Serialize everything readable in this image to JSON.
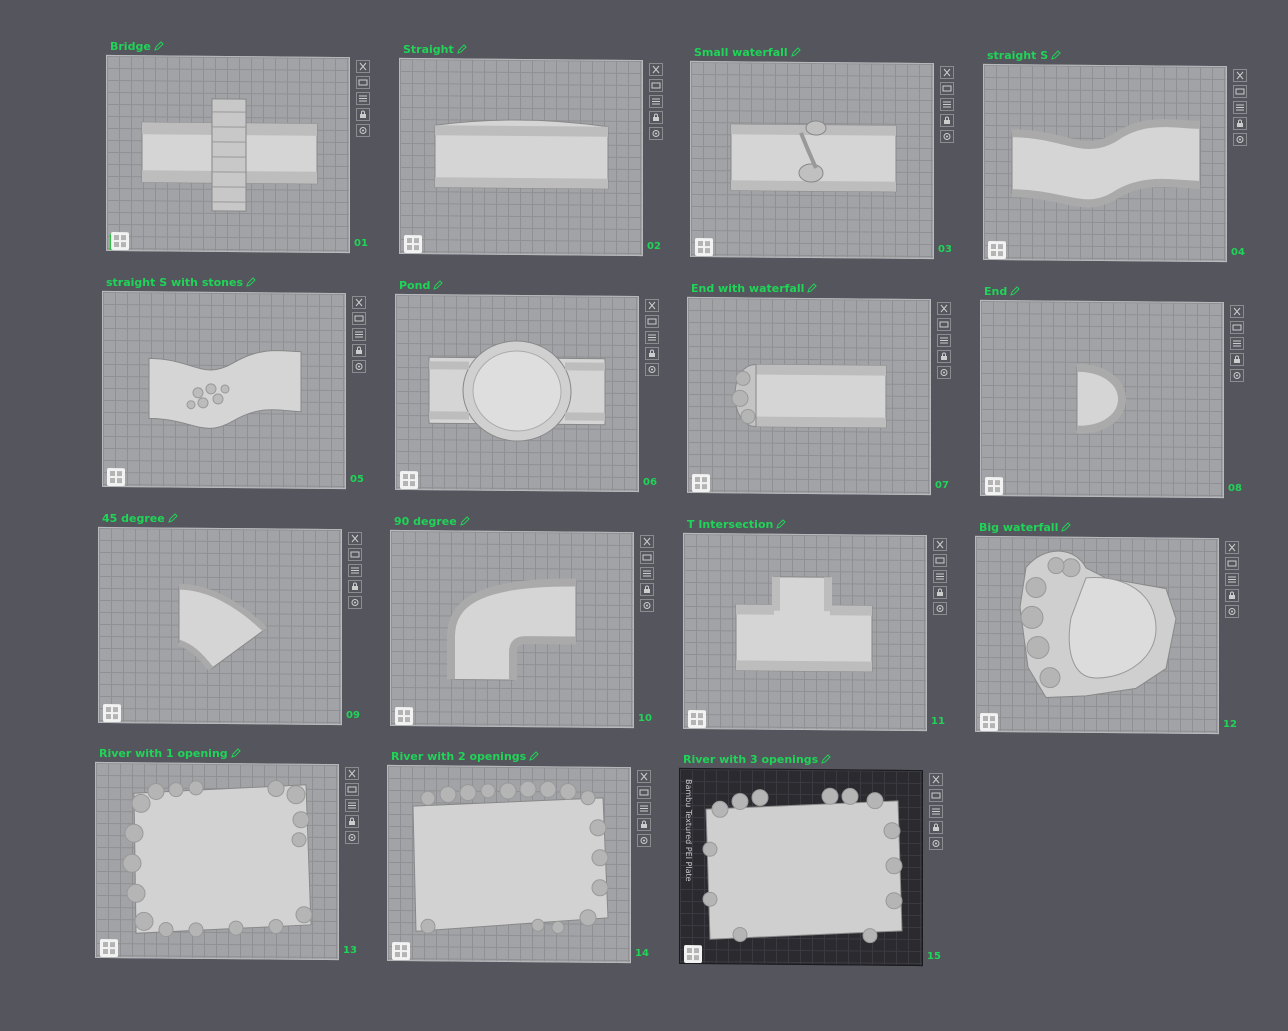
{
  "accent_color": "#1fd457",
  "plate_texture_text": "Bambu Textured PEI Plate",
  "plates": [
    {
      "title": "Bridge",
      "number": "01",
      "model": "bridge"
    },
    {
      "title": "Straight",
      "number": "02",
      "model": "straight"
    },
    {
      "title": "Small waterfall",
      "number": "03",
      "model": "small-waterfall"
    },
    {
      "title": "straight S",
      "number": "04",
      "model": "straight-s"
    },
    {
      "title": "straight S with stones",
      "number": "05",
      "model": "straight-s-stones"
    },
    {
      "title": "Pond",
      "number": "06",
      "model": "pond"
    },
    {
      "title": "End with waterfall",
      "number": "07",
      "model": "end-waterfall"
    },
    {
      "title": "End",
      "number": "08",
      "model": "end"
    },
    {
      "title": "45 degree",
      "number": "09",
      "model": "45-degree"
    },
    {
      "title": "90 degree",
      "number": "10",
      "model": "90-degree"
    },
    {
      "title": "T Intersection",
      "number": "11",
      "model": "t-intersection"
    },
    {
      "title": "Big waterfall",
      "number": "12",
      "model": "big-waterfall"
    },
    {
      "title": "River with 1 opening",
      "number": "13",
      "model": "river-1"
    },
    {
      "title": "River with 2 openings",
      "number": "14",
      "model": "river-2"
    },
    {
      "title": "River with 3 openings",
      "number": "15",
      "model": "river-3",
      "selected": true
    }
  ],
  "plate_tools": [
    "close-icon",
    "arrange-icon",
    "slice-icon",
    "lock-icon",
    "settings-icon"
  ]
}
